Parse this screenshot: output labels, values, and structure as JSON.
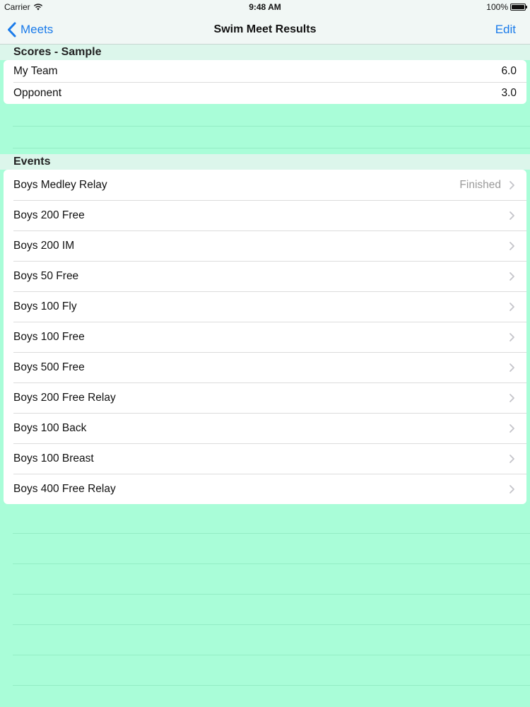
{
  "status_bar": {
    "carrier": "Carrier",
    "time": "9:48 AM",
    "battery": "100%",
    "battery_level": 1.0
  },
  "nav": {
    "back_label": "Meets",
    "title": "Swim Meet Results",
    "edit_label": "Edit"
  },
  "scores": {
    "header": "Scores - Sample",
    "rows": [
      {
        "label": "My Team",
        "value": "6.0"
      },
      {
        "label": "Opponent",
        "value": "3.0"
      }
    ]
  },
  "events": {
    "header": "Events",
    "items": [
      {
        "label": "Boys Medley Relay",
        "status": "Finished"
      },
      {
        "label": "Boys 200 Free",
        "status": ""
      },
      {
        "label": "Boys 200 IM",
        "status": ""
      },
      {
        "label": "Boys 50 Free",
        "status": ""
      },
      {
        "label": "Boys 100 Fly",
        "status": ""
      },
      {
        "label": "Boys 100 Free",
        "status": ""
      },
      {
        "label": "Boys 500 Free",
        "status": ""
      },
      {
        "label": "Boys 200 Free Relay",
        "status": ""
      },
      {
        "label": "Boys 100 Back",
        "status": ""
      },
      {
        "label": "Boys 100 Breast",
        "status": ""
      },
      {
        "label": "Boys 400 Free Relay",
        "status": ""
      }
    ]
  },
  "icons": {
    "back": "chevron-left-icon",
    "row_disclosure": "chevron-right-icon",
    "wifi": "wifi-icon",
    "battery": "battery-icon"
  },
  "colors": {
    "background": "#a9fdd8",
    "bar": "#f1f7f5",
    "accent": "#1a7bea",
    "section_header": "#dcf6eb",
    "status_text": "#9a9a9a"
  }
}
